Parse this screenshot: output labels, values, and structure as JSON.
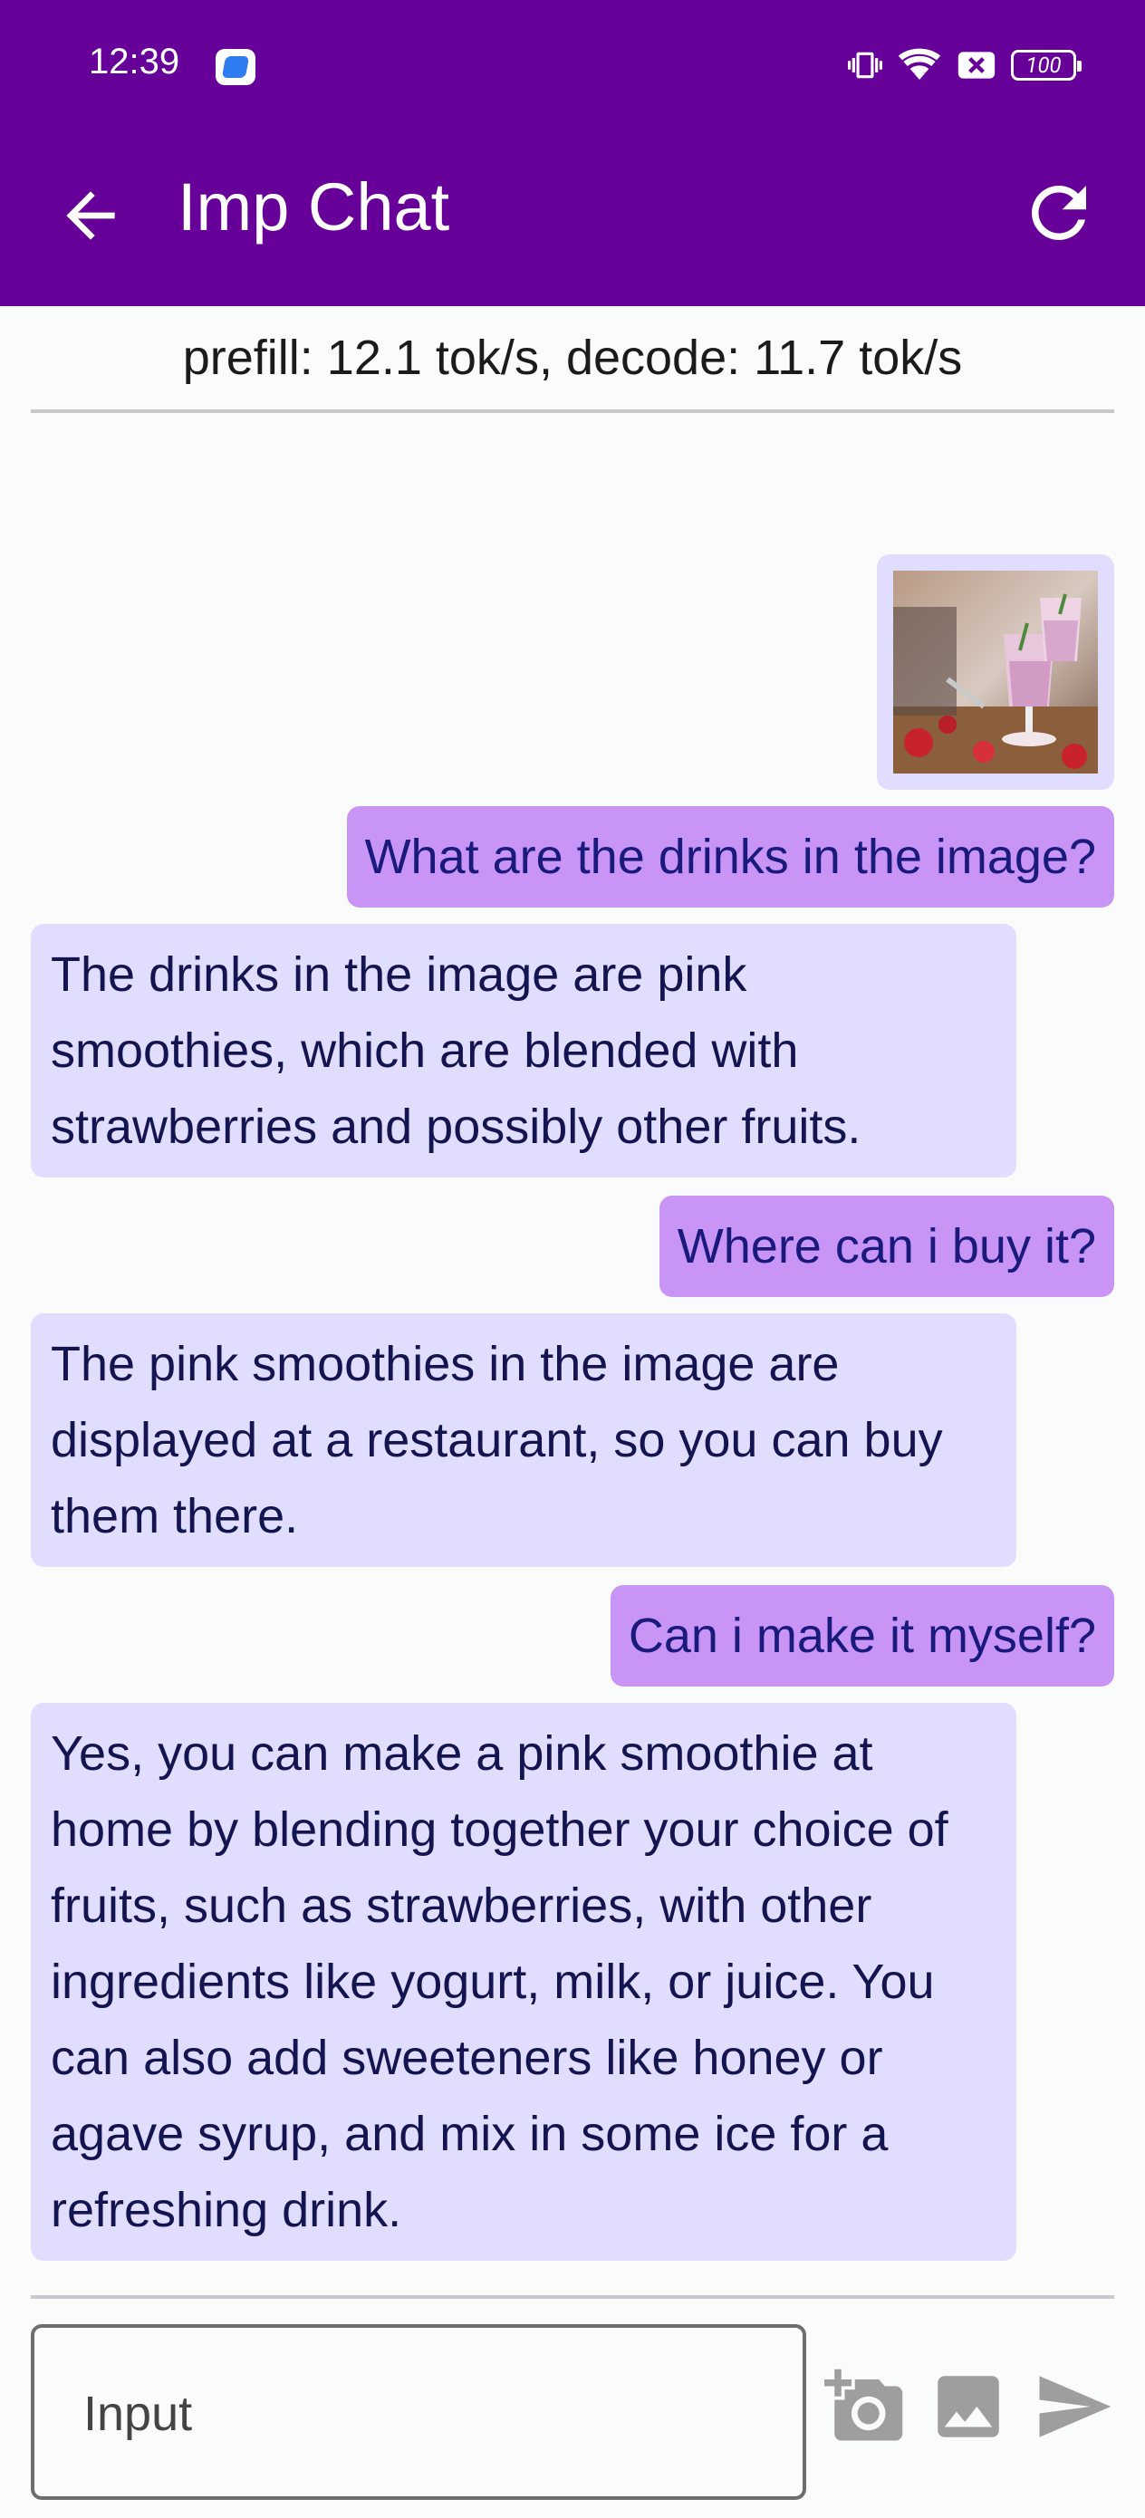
{
  "status_bar": {
    "time": "12:39",
    "battery": "100",
    "icons": [
      "app-icon",
      "vibrate-icon",
      "wifi-icon",
      "no-sim-icon",
      "battery-icon"
    ]
  },
  "app_bar": {
    "title": "Imp Chat",
    "back_icon": "arrow-back-icon",
    "refresh_icon": "refresh-icon"
  },
  "stats": {
    "text": "prefill: 12.1 tok/s, decode: 11.7 tok/s"
  },
  "messages": [
    {
      "role": "user",
      "type": "image",
      "icon": "image-thumbnail"
    },
    {
      "role": "user",
      "text": "What are the drinks in the image?"
    },
    {
      "role": "assistant",
      "text": "The drinks in the image are pink smoothies, which are blended with strawberries and possibly other fruits."
    },
    {
      "role": "user",
      "text": "Where can i buy it?"
    },
    {
      "role": "assistant",
      "text": "The pink smoothies in the image are displayed at a restaurant, so you can buy them there."
    },
    {
      "role": "user",
      "text": "Can i make it myself?"
    },
    {
      "role": "assistant",
      "text": "Yes, you can make a pink smoothie at home by blending together your choice of fruits, such as strawberries, with other ingredients like yogurt, milk, or juice. You can also add sweeteners like honey or agave syrup, and mix in some ice for a refreshing drink."
    }
  ],
  "composer": {
    "placeholder": "Input",
    "camera_icon": "add-photo-camera-icon",
    "gallery_icon": "image-icon",
    "send_icon": "send-icon"
  },
  "colors": {
    "app_bar": "#660099",
    "user_bubble": "#c895f7",
    "assistant_bubble": "#e0ddff",
    "user_text": "#1a1a7c",
    "icon_grey": "#9e9e9e"
  }
}
